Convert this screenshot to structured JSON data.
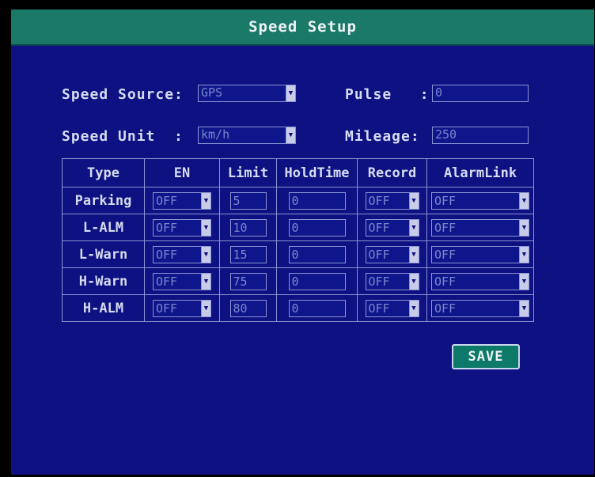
{
  "title": "Speed Setup",
  "speed_source": {
    "label": "Speed Source:",
    "value": "GPS"
  },
  "pulse": {
    "label": "Pulse   :",
    "value": "0"
  },
  "speed_unit": {
    "label": "Speed Unit  :",
    "value": "km/h"
  },
  "mileage": {
    "label": "Mileage:",
    "value": "250"
  },
  "table": {
    "headers": [
      "Type",
      "EN",
      "Limit",
      "HoldTime",
      "Record",
      "AlarmLink"
    ],
    "rows": [
      {
        "type": "Parking",
        "en": "OFF",
        "limit": "5",
        "holdtime": "0",
        "record": "OFF",
        "alarmlink": "OFF"
      },
      {
        "type": "L-ALM",
        "en": "OFF",
        "limit": "10",
        "holdtime": "0",
        "record": "OFF",
        "alarmlink": "OFF"
      },
      {
        "type": "L-Warn",
        "en": "OFF",
        "limit": "15",
        "holdtime": "0",
        "record": "OFF",
        "alarmlink": "OFF"
      },
      {
        "type": "H-Warn",
        "en": "OFF",
        "limit": "75",
        "holdtime": "0",
        "record": "OFF",
        "alarmlink": "OFF"
      },
      {
        "type": "H-ALM",
        "en": "OFF",
        "limit": "80",
        "holdtime": "0",
        "record": "OFF",
        "alarmlink": "OFF"
      }
    ]
  },
  "save_label": "SAVE",
  "icons": {
    "dropdown": "chevron-down-icon"
  }
}
